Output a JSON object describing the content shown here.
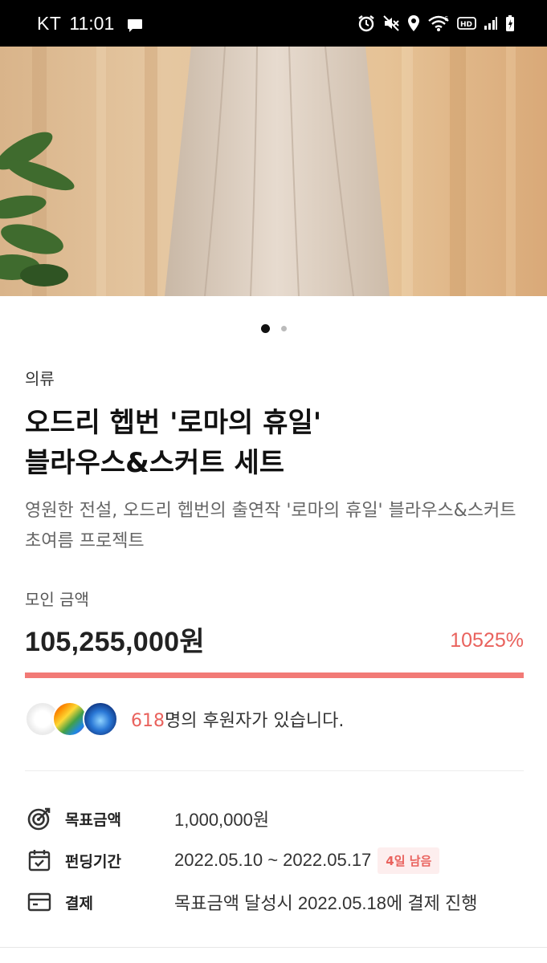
{
  "status_bar": {
    "carrier": "KT",
    "time": "11:01",
    "icons": [
      "message-icon",
      "alarm-icon",
      "mute-icon",
      "location-icon",
      "wifi-icon",
      "hd-icon",
      "signal-icon",
      "battery-icon"
    ],
    "hd_label": "HD"
  },
  "hero": {
    "pager": {
      "total": 2,
      "active_index": 0
    }
  },
  "project": {
    "category": "의류",
    "title_line1": "오드리 헵번 '로마의 휴일'",
    "title_line2": "블라우스&스커트 세트",
    "subtitle": "영원한 전설, 오드리 헵번의 출연작 '로마의 휴일' 블라우스&스커트 초여름 프로젝트"
  },
  "funding": {
    "raised_label": "모인 금액",
    "raised_amount": "105,255,000원",
    "percent_text": "10525%",
    "progress_fraction": 1.0,
    "accent_color": "#e9625d"
  },
  "backers": {
    "count": "618",
    "suffix": "명의 후원자가 있습니다."
  },
  "details": {
    "goal_label": "목표금액",
    "goal_value": "1,000,000원",
    "period_label": "펀딩기간",
    "period_value": "2022.05.10 ~ 2022.05.17",
    "remaining_badge": "4일 남음",
    "payment_label": "결제",
    "payment_value": "목표금액 달성시 2022.05.18에 결제 진행"
  }
}
